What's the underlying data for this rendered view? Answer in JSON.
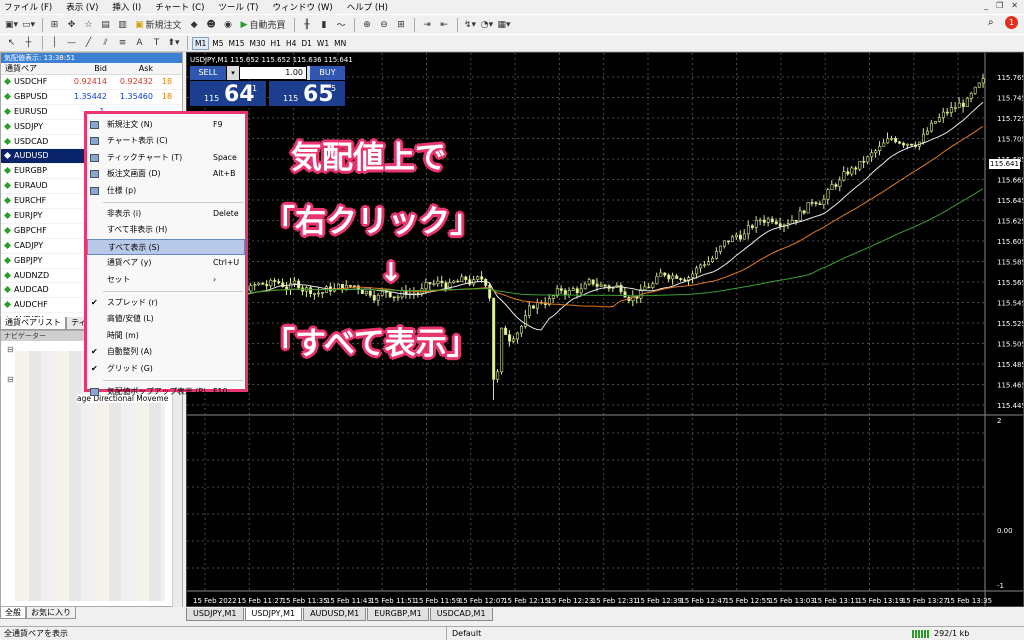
{
  "menu": {
    "items": [
      "ファイル (F)",
      "表示 (V)",
      "挿入 (I)",
      "チャート (C)",
      "ツール (T)",
      "ウィンドウ (W)",
      "ヘルプ (H)"
    ]
  },
  "toolbar": {
    "new_order": "新規注文",
    "autotrade": "自動売買",
    "notif_count": "1",
    "timeframes": [
      "M1",
      "M5",
      "M15",
      "M30",
      "H1",
      "H4",
      "D1",
      "W1",
      "MN"
    ],
    "active_timeframe": "M1"
  },
  "market_watch": {
    "title": "気配値表示: 13:38:51",
    "headers": {
      "symbol": "通貨ペア",
      "bid": "Bid",
      "ask": "Ask"
    },
    "rows": [
      {
        "sym": "USDCHF",
        "bid": "0.92414",
        "ask": "0.92432",
        "sp": "18"
      },
      {
        "sym": "GBPUSD",
        "bid": "1.35442",
        "ask": "1.35460",
        "sp": "18"
      },
      {
        "sym": "EURUSD",
        "bid": "1.",
        "ask": "",
        "sp": ""
      },
      {
        "sym": "USDJPY",
        "bid": "11",
        "ask": "",
        "sp": ""
      },
      {
        "sym": "USDCAD",
        "bid": "1.",
        "ask": "",
        "sp": ""
      },
      {
        "sym": "AUDUSD",
        "bid": "0.",
        "ask": "",
        "sp": ""
      },
      {
        "sym": "EURGBP",
        "bid": "0.",
        "ask": "",
        "sp": ""
      },
      {
        "sym": "EURAUD",
        "bid": "1.",
        "ask": "",
        "sp": ""
      },
      {
        "sym": "EURCHF",
        "bid": "1.",
        "ask": "",
        "sp": ""
      },
      {
        "sym": "EURJPY",
        "bid": "13",
        "ask": "",
        "sp": ""
      },
      {
        "sym": "GBPCHF",
        "bid": "1.",
        "ask": "",
        "sp": ""
      },
      {
        "sym": "CADJPY",
        "bid": "9",
        "ask": "",
        "sp": ""
      },
      {
        "sym": "GBPJPY",
        "bid": "15",
        "ask": "",
        "sp": ""
      },
      {
        "sym": "AUDNZD",
        "bid": "1.",
        "ask": "",
        "sp": ""
      },
      {
        "sym": "AUDCAD",
        "bid": "0.",
        "ask": "",
        "sp": ""
      },
      {
        "sym": "AUDCHF",
        "bid": "0.",
        "ask": "",
        "sp": ""
      },
      {
        "sym": "AUDJPY",
        "bid": "8",
        "ask": "",
        "sp": ""
      }
    ],
    "selected": "AUDUSD",
    "tabs": [
      "通貨ペアリスト",
      "ティ"
    ]
  },
  "navigator": {
    "title": "ナビゲーター",
    "visible_item": "age Directional Moveme",
    "tabs": [
      "全般",
      "お気に入り"
    ]
  },
  "context_menu": {
    "items": [
      {
        "label": "新規注文 (N)",
        "shortcut": "F9",
        "check": false,
        "icon": true
      },
      {
        "label": "チャート表示 (C)",
        "shortcut": "",
        "check": false,
        "icon": true
      },
      {
        "label": "ティックチャート (T)",
        "shortcut": "Space",
        "check": false,
        "icon": true
      },
      {
        "label": "板注文画面 (D)",
        "shortcut": "Alt+B",
        "check": false,
        "icon": true
      },
      {
        "label": "仕様 (p)",
        "shortcut": "",
        "check": false,
        "icon": true
      },
      {
        "sep": true
      },
      {
        "label": "非表示 (i)",
        "shortcut": "Delete",
        "check": false,
        "icon": false
      },
      {
        "label": "すべて非表示 (H)",
        "shortcut": "",
        "check": false,
        "icon": false
      },
      {
        "label": "すべて表示 (S)",
        "shortcut": "",
        "check": false,
        "icon": false,
        "highlighted": true
      },
      {
        "label": "通貨ペア (y)",
        "shortcut": "Ctrl+U",
        "check": false,
        "icon": false
      },
      {
        "label": "セット",
        "shortcut": "›",
        "check": false,
        "icon": false
      },
      {
        "sep": true
      },
      {
        "label": "スプレッド (r)",
        "shortcut": "",
        "check": true,
        "icon": false
      },
      {
        "label": "高値/安値 (L)",
        "shortcut": "",
        "check": false,
        "icon": false
      },
      {
        "label": "時間 (m)",
        "shortcut": "",
        "check": false,
        "icon": false
      },
      {
        "label": "自動整列 (A)",
        "shortcut": "",
        "check": true,
        "icon": false
      },
      {
        "label": "グリッド (G)",
        "shortcut": "",
        "check": true,
        "icon": false
      },
      {
        "sep": true
      },
      {
        "label": "気配値ポップアップ表示 (P)",
        "shortcut": "F10",
        "check": false,
        "icon": true
      }
    ]
  },
  "chart": {
    "title": "USDJPY,M1  115.652 115.652 115.636 115.641",
    "sell_label": "SELL",
    "buy_label": "BUY",
    "lot": "1.00",
    "sell_price": {
      "prefix": "115",
      "big": "64",
      "sup": "1"
    },
    "buy_price": {
      "prefix": "115",
      "big": "65",
      "sup": "5"
    },
    "current_price": "115.641",
    "yaxis": [
      "115.765",
      "115.745",
      "115.725",
      "115.705",
      "115.685",
      "115.665",
      "115.645",
      "115.625",
      "115.605",
      "115.585",
      "115.565",
      "115.545",
      "115.525",
      "115.505",
      "115.485",
      "115.465",
      "115.445"
    ],
    "ind_axis": [
      "2",
      "0.00",
      "-1"
    ],
    "xaxis": [
      "15 Feb 2022",
      "15 Feb 11:27",
      "15 Feb 11:35",
      "15 Feb 11:43",
      "15 Feb 11:51",
      "15 Feb 11:59",
      "15 Feb 12:07",
      "15 Feb 12:15",
      "15 Feb 12:23",
      "15 Feb 12:31",
      "15 Feb 12:39",
      "15 Feb 12:47",
      "15 Feb 12:55",
      "15 Feb 13:03",
      "15 Feb 13:11",
      "15 Feb 13:19",
      "15 Feb 13:27",
      "15 Feb 13:35"
    ]
  },
  "chart_tabs": [
    "USDJPY,M1",
    "USDJPY,M1",
    "AUDUSD,M1",
    "EURGBP,M1",
    "USDCAD,M1"
  ],
  "active_chart_tab": 1,
  "annotations": {
    "a1": "気配値上で",
    "a2": "「右クリック」",
    "arrow": "↓",
    "a3": "「すべて表示」"
  },
  "status": {
    "left": "全通貨ペアを表示",
    "profile": "Default",
    "traffic": "292/1 kb"
  }
}
